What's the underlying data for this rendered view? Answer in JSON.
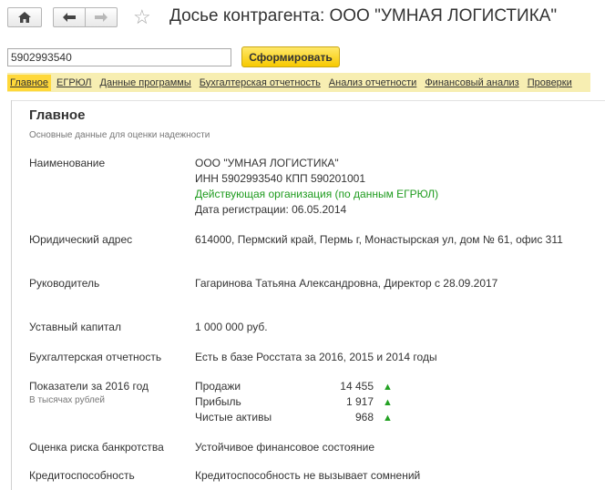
{
  "header": {
    "title": "Досье контрагента: ООО \"УМНАЯ ЛОГИСТИКА\""
  },
  "search": {
    "value": "5902993540"
  },
  "generate_button": {
    "label": "Сформировать"
  },
  "tabs": [
    {
      "label": "Главное",
      "active": true
    },
    {
      "label": "ЕГРЮЛ"
    },
    {
      "label": "Данные программы"
    },
    {
      "label": "Бухгалтерская отчетность"
    },
    {
      "label": "Анализ отчетности"
    },
    {
      "label": "Финансовый анализ"
    },
    {
      "label": "Проверки"
    }
  ],
  "main": {
    "title": "Главное",
    "subtitle": "Основные данные для оценки надежности",
    "name": {
      "label": "Наименование",
      "line1": "ООО \"УМНАЯ ЛОГИСТИКА\"",
      "line2": "ИНН 5902993540 КПП 590201001",
      "status": "Действующая организация (по данным ЕГРЮЛ)",
      "registration": "Дата регистрации: 06.05.2014"
    },
    "address": {
      "label": "Юридический адрес",
      "value": "614000, Пермский край, Пермь г, Монастырская ул, дом № 61, офис 311"
    },
    "director": {
      "label": "Руководитель",
      "value": "Гагаринова Татьяна Александровна, Директор с 28.09.2017"
    },
    "capital": {
      "label": "Уставный капитал",
      "value": "1 000 000 руб."
    },
    "accounting": {
      "label": "Бухгалтерская отчетность",
      "value": "Есть в базе Росстата за 2016, 2015 и 2014 годы"
    },
    "indicators": {
      "label": "Показатели за 2016 год",
      "hint": "В тысячах рублей",
      "rows": [
        {
          "name": "Продажи",
          "value": "14 455",
          "trend": "up"
        },
        {
          "name": "Прибыль",
          "value": "1 917",
          "trend": "up"
        },
        {
          "name": "Чистые активы",
          "value": "968",
          "trend": "up"
        }
      ]
    },
    "bankruptcy": {
      "label": "Оценка риска банкротства",
      "value": "Устойчивое финансовое состояние"
    },
    "credit": {
      "label": "Кредитоспособность",
      "value": "Кредитоспособность не вызывает сомнений"
    }
  },
  "colors": {
    "accent": "#ffd83a",
    "tabs_bg": "#f7eeb2",
    "status_green": "#1e9b1e",
    "trend_up": "#23a123"
  }
}
